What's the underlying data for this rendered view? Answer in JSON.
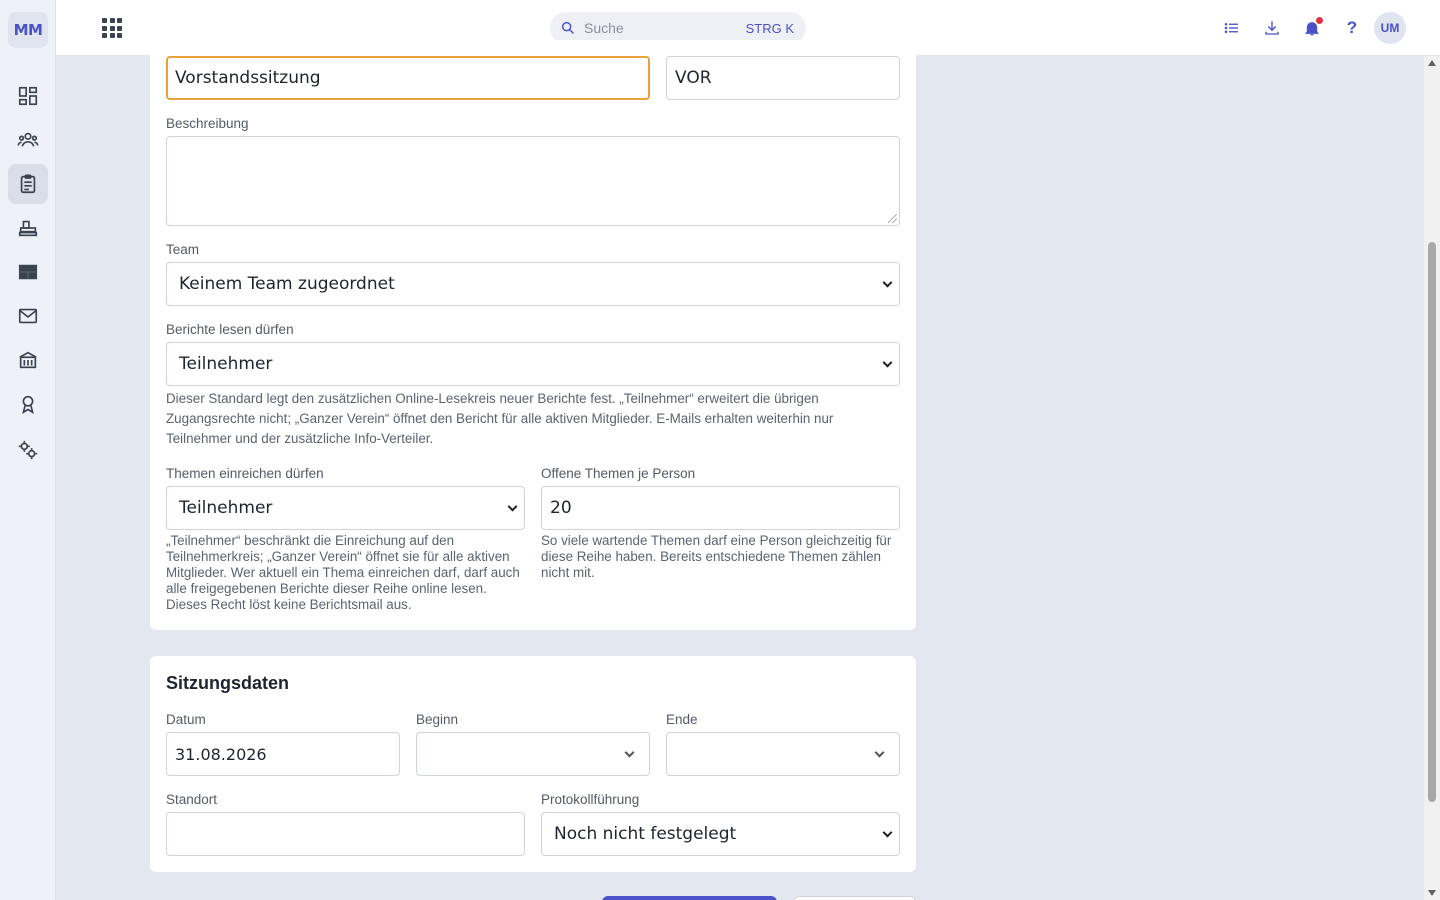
{
  "brand": {
    "logo": "MM"
  },
  "sidebar": {
    "items": [
      {
        "name": "dashboard"
      },
      {
        "name": "members"
      },
      {
        "name": "meetings",
        "active": true
      },
      {
        "name": "events"
      },
      {
        "name": "layout"
      },
      {
        "name": "mail"
      },
      {
        "name": "organization"
      },
      {
        "name": "awards"
      },
      {
        "name": "settings"
      }
    ]
  },
  "topbar": {
    "search_placeholder": "Suche",
    "search_shortcut": "STRG K",
    "help_label": "?",
    "avatar": "UM",
    "accent": "#4a51c9"
  },
  "form": {
    "name_value": "Vorstandssitzung",
    "short_value": "VOR",
    "description_label": "Beschreibung",
    "description_value": "",
    "team_label": "Team",
    "team_value": "Keinem Team zugeordnet",
    "reports_label": "Berichte lesen dürfen",
    "reports_value": "Teilnehmer",
    "reports_help": "Dieser Standard legt den zusätzlichen Online-Lesekreis neuer Berichte fest. „Teilnehmer“ erweitert die übrigen Zugangsrechte nicht; „Ganzer Verein“ öffnet den Bericht für alle aktiven Mitglieder. E-Mails erhalten weiterhin nur Teilnehmer und der zusätzliche Info-Verteiler.",
    "topics_label": "Themen einreichen dürfen",
    "topics_value": "Teilnehmer",
    "topics_help": "„Teilnehmer“ beschränkt die Einreichung auf den Teilnehmerkreis; „Ganzer Verein“ öffnet sie für alle aktiven Mitglieder. Wer aktuell ein Thema einreichen darf, darf auch alle freigegebenen Berichte dieser Reihe online lesen. Dieses Recht löst keine Berichtsmail aus.",
    "open_topics_label": "Offene Themen je Person",
    "open_topics_value": "20",
    "open_topics_help": "So viele wartende Themen darf eine Person gleichzeitig für diese Reihe haben. Bereits entschiedene Themen zählen nicht mit."
  },
  "session": {
    "title": "Sitzungsdaten",
    "date_label": "Datum",
    "date_value": "31.08.2026",
    "start_label": "Beginn",
    "start_value": "",
    "end_label": "Ende",
    "end_value": "",
    "location_label": "Standort",
    "location_value": "",
    "minutes_label": "Protokollführung",
    "minutes_value": "Noch nicht festgelegt"
  }
}
